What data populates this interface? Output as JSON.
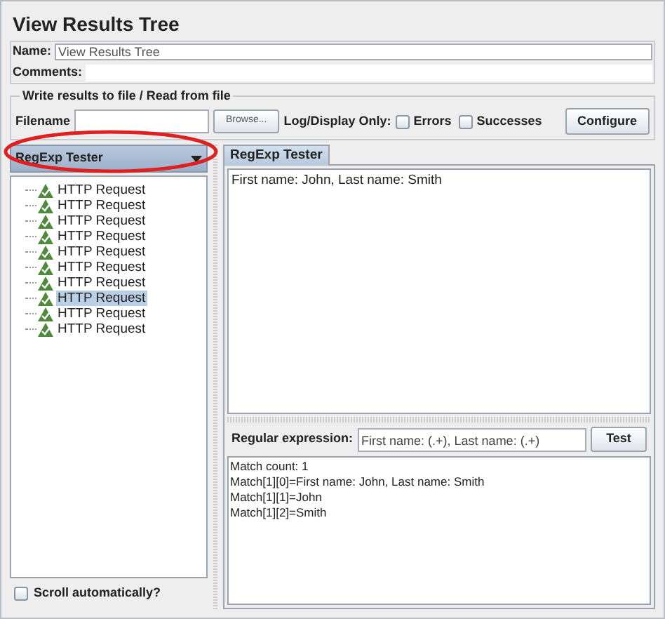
{
  "title": "View Results Tree",
  "name": {
    "label": "Name:",
    "value": "View Results Tree"
  },
  "comments": {
    "label": "Comments:"
  },
  "file_group": {
    "legend": "Write results to file / Read from file",
    "filename_label": "Filename",
    "browse": "Browse...",
    "log_label": "Log/Display Only:",
    "options": [
      {
        "label": "Errors",
        "checked": false
      },
      {
        "label": "Successes",
        "checked": false
      }
    ],
    "configure": "Configure"
  },
  "renderer": {
    "value": "RegExp Tester"
  },
  "tree": [
    {
      "label": "HTTP Request",
      "selected": false
    },
    {
      "label": "HTTP Request",
      "selected": false
    },
    {
      "label": "HTTP Request",
      "selected": false
    },
    {
      "label": "HTTP Request",
      "selected": false
    },
    {
      "label": "HTTP Request",
      "selected": false
    },
    {
      "label": "HTTP Request",
      "selected": false
    },
    {
      "label": "HTTP Request",
      "selected": false
    },
    {
      "label": "HTTP Request",
      "selected": true
    },
    {
      "label": "HTTP Request",
      "selected": false
    },
    {
      "label": "HTTP Request",
      "selected": false
    }
  ],
  "scroll_auto": {
    "label": "Scroll automatically?",
    "checked": false
  },
  "tabs": [
    {
      "label": "RegExp Tester",
      "selected": true
    }
  ],
  "response": "First name: John, Last name: Smith",
  "regex": {
    "label": "Regular expression:",
    "value": "First name: (.+), Last name: (.+)",
    "button": "Test"
  },
  "results": [
    "Match count: 1",
    "Match[1][0]=First name: John, Last name: Smith",
    "Match[1][1]=John",
    "Match[1][2]=Smith"
  ]
}
